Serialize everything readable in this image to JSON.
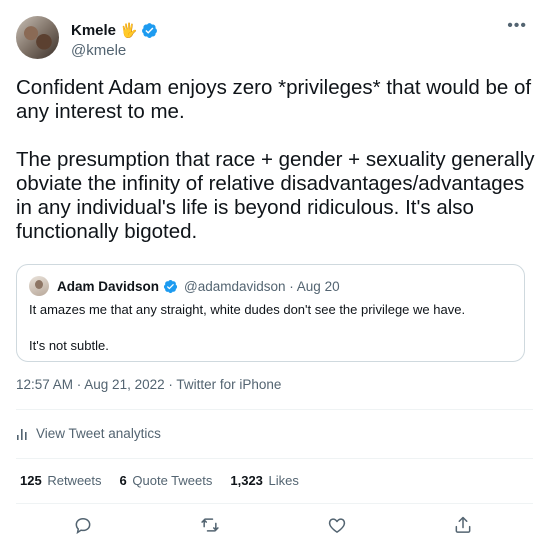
{
  "author": {
    "display_name": "Kmele",
    "emoji": "🖐",
    "handle": "@kmele"
  },
  "tweet": {
    "paragraphs": [
      "Confident Adam enjoys zero *privileges* that would be of any interest to me.",
      "The presumption that race + gender + sexuality generally obviate the infinity of relative disadvantages/advantages in any individual's life is beyond ridiculous. It's also functionally bigoted."
    ]
  },
  "quote": {
    "display_name": "Adam Davidson",
    "handle_date": "@adamdavidson · Aug 20",
    "paragraphs": [
      "It amazes me that any straight, white dudes don't see the privilege we have.",
      "It's not subtle."
    ]
  },
  "meta": {
    "timestamp": "12:57 AM · Aug 21, 2022 · Twitter for iPhone"
  },
  "analytics": {
    "label": "View Tweet analytics"
  },
  "stats": {
    "retweets": {
      "count": "125",
      "label": "Retweets"
    },
    "quotes": {
      "count": "6",
      "label": "Quote Tweets"
    },
    "likes": {
      "count": "1,323",
      "label": "Likes"
    }
  },
  "icons": {
    "more": "more-icon",
    "verified": "verified-icon",
    "analytics": "analytics-icon",
    "reply": "reply-icon",
    "retweet": "retweet-icon",
    "like": "like-icon",
    "share": "share-icon"
  },
  "colors": {
    "verified": "#1d9bf0",
    "secondary_text": "#536471",
    "primary_text": "#0f1419",
    "divider": "#eff3f4",
    "quote_border": "#cfd9de"
  }
}
